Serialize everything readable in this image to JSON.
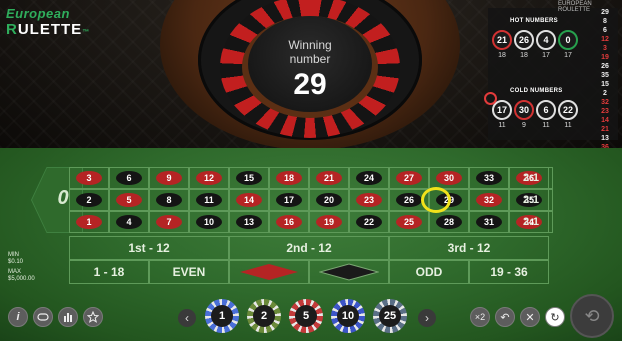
{
  "logo": {
    "line1": "European",
    "line2a": "R",
    "line2b": "ULETTE",
    "tm": "™"
  },
  "header": {
    "title": "EUROPEAN ROULETTE"
  },
  "winning": {
    "label_line1": "Winning",
    "label_line2": "number",
    "number": "29"
  },
  "hot_numbers": {
    "title": "HOT NUMBERS",
    "balls": [
      {
        "num": "21",
        "color": "red",
        "count": "18"
      },
      {
        "num": "26",
        "color": "black",
        "count": "18"
      },
      {
        "num": "4",
        "color": "black",
        "count": "17"
      },
      {
        "num": "0",
        "color": "green",
        "count": "17"
      }
    ]
  },
  "cold_numbers": {
    "title": "COLD NUMBERS",
    "balls": [
      {
        "num": "17",
        "color": "black",
        "count": "11"
      },
      {
        "num": "30",
        "color": "red",
        "count": "9"
      },
      {
        "num": "6",
        "color": "black",
        "count": "11"
      },
      {
        "num": "22",
        "color": "black",
        "count": "11"
      }
    ]
  },
  "history": [
    {
      "n": "29",
      "c": "w"
    },
    {
      "n": "8",
      "c": "w"
    },
    {
      "n": "6",
      "c": "w"
    },
    {
      "n": "12",
      "c": "r"
    },
    {
      "n": "3",
      "c": "r"
    },
    {
      "n": "19",
      "c": "r"
    },
    {
      "n": "26",
      "c": "w"
    },
    {
      "n": "35",
      "c": "w"
    },
    {
      "n": "15",
      "c": "w"
    },
    {
      "n": "2",
      "c": "w"
    },
    {
      "n": "32",
      "c": "r"
    },
    {
      "n": "23",
      "c": "r"
    },
    {
      "n": "14",
      "c": "r"
    },
    {
      "n": "21",
      "c": "r"
    },
    {
      "n": "13",
      "c": "w"
    },
    {
      "n": "36",
      "c": "r"
    }
  ],
  "table": {
    "zero": "0",
    "rows": [
      [
        {
          "n": "3",
          "c": "red"
        },
        {
          "n": "6",
          "c": "black"
        },
        {
          "n": "9",
          "c": "red"
        },
        {
          "n": "12",
          "c": "red"
        },
        {
          "n": "15",
          "c": "black"
        },
        {
          "n": "18",
          "c": "red"
        },
        {
          "n": "21",
          "c": "red"
        },
        {
          "n": "24",
          "c": "black"
        },
        {
          "n": "27",
          "c": "red"
        },
        {
          "n": "30",
          "c": "red"
        },
        {
          "n": "33",
          "c": "black"
        },
        {
          "n": "36",
          "c": "red"
        }
      ],
      [
        {
          "n": "2",
          "c": "black"
        },
        {
          "n": "5",
          "c": "red"
        },
        {
          "n": "8",
          "c": "black"
        },
        {
          "n": "11",
          "c": "black"
        },
        {
          "n": "14",
          "c": "red"
        },
        {
          "n": "17",
          "c": "black"
        },
        {
          "n": "20",
          "c": "black"
        },
        {
          "n": "23",
          "c": "red"
        },
        {
          "n": "26",
          "c": "black"
        },
        {
          "n": "29",
          "c": "black"
        },
        {
          "n": "32",
          "c": "red"
        },
        {
          "n": "35",
          "c": "black"
        }
      ],
      [
        {
          "n": "1",
          "c": "red"
        },
        {
          "n": "4",
          "c": "black"
        },
        {
          "n": "7",
          "c": "red"
        },
        {
          "n": "10",
          "c": "black"
        },
        {
          "n": "13",
          "c": "black"
        },
        {
          "n": "16",
          "c": "red"
        },
        {
          "n": "19",
          "c": "red"
        },
        {
          "n": "22",
          "c": "black"
        },
        {
          "n": "25",
          "c": "red"
        },
        {
          "n": "28",
          "c": "black"
        },
        {
          "n": "31",
          "c": "black"
        },
        {
          "n": "34",
          "c": "red"
        }
      ]
    ],
    "columns": [
      "2:1",
      "2:1",
      "2:1"
    ],
    "dozens": [
      "1st - 12",
      "2nd - 12",
      "3rd - 12"
    ],
    "outside": {
      "low": "1 - 18",
      "even": "EVEN",
      "odd": "ODD",
      "high": "19 - 36"
    }
  },
  "limits": {
    "min_label": "MIN",
    "min_value": "$0.10",
    "max_label": "MAX",
    "max_value": "$5,000.00"
  },
  "buttons": {
    "info": "i",
    "prev": "‹",
    "next": "›",
    "double": "×2",
    "undo": "↶",
    "clear": "✕",
    "rebet": "↻",
    "spin": "⟲"
  },
  "chips": [
    {
      "value": "1",
      "color": "#4a6fd8"
    },
    {
      "value": "2",
      "color": "#6b8a3a"
    },
    {
      "value": "5",
      "color": "#c23a3a"
    },
    {
      "value": "10",
      "color": "#3c55c8"
    },
    {
      "value": "25",
      "color": "#5a6f86"
    }
  ]
}
